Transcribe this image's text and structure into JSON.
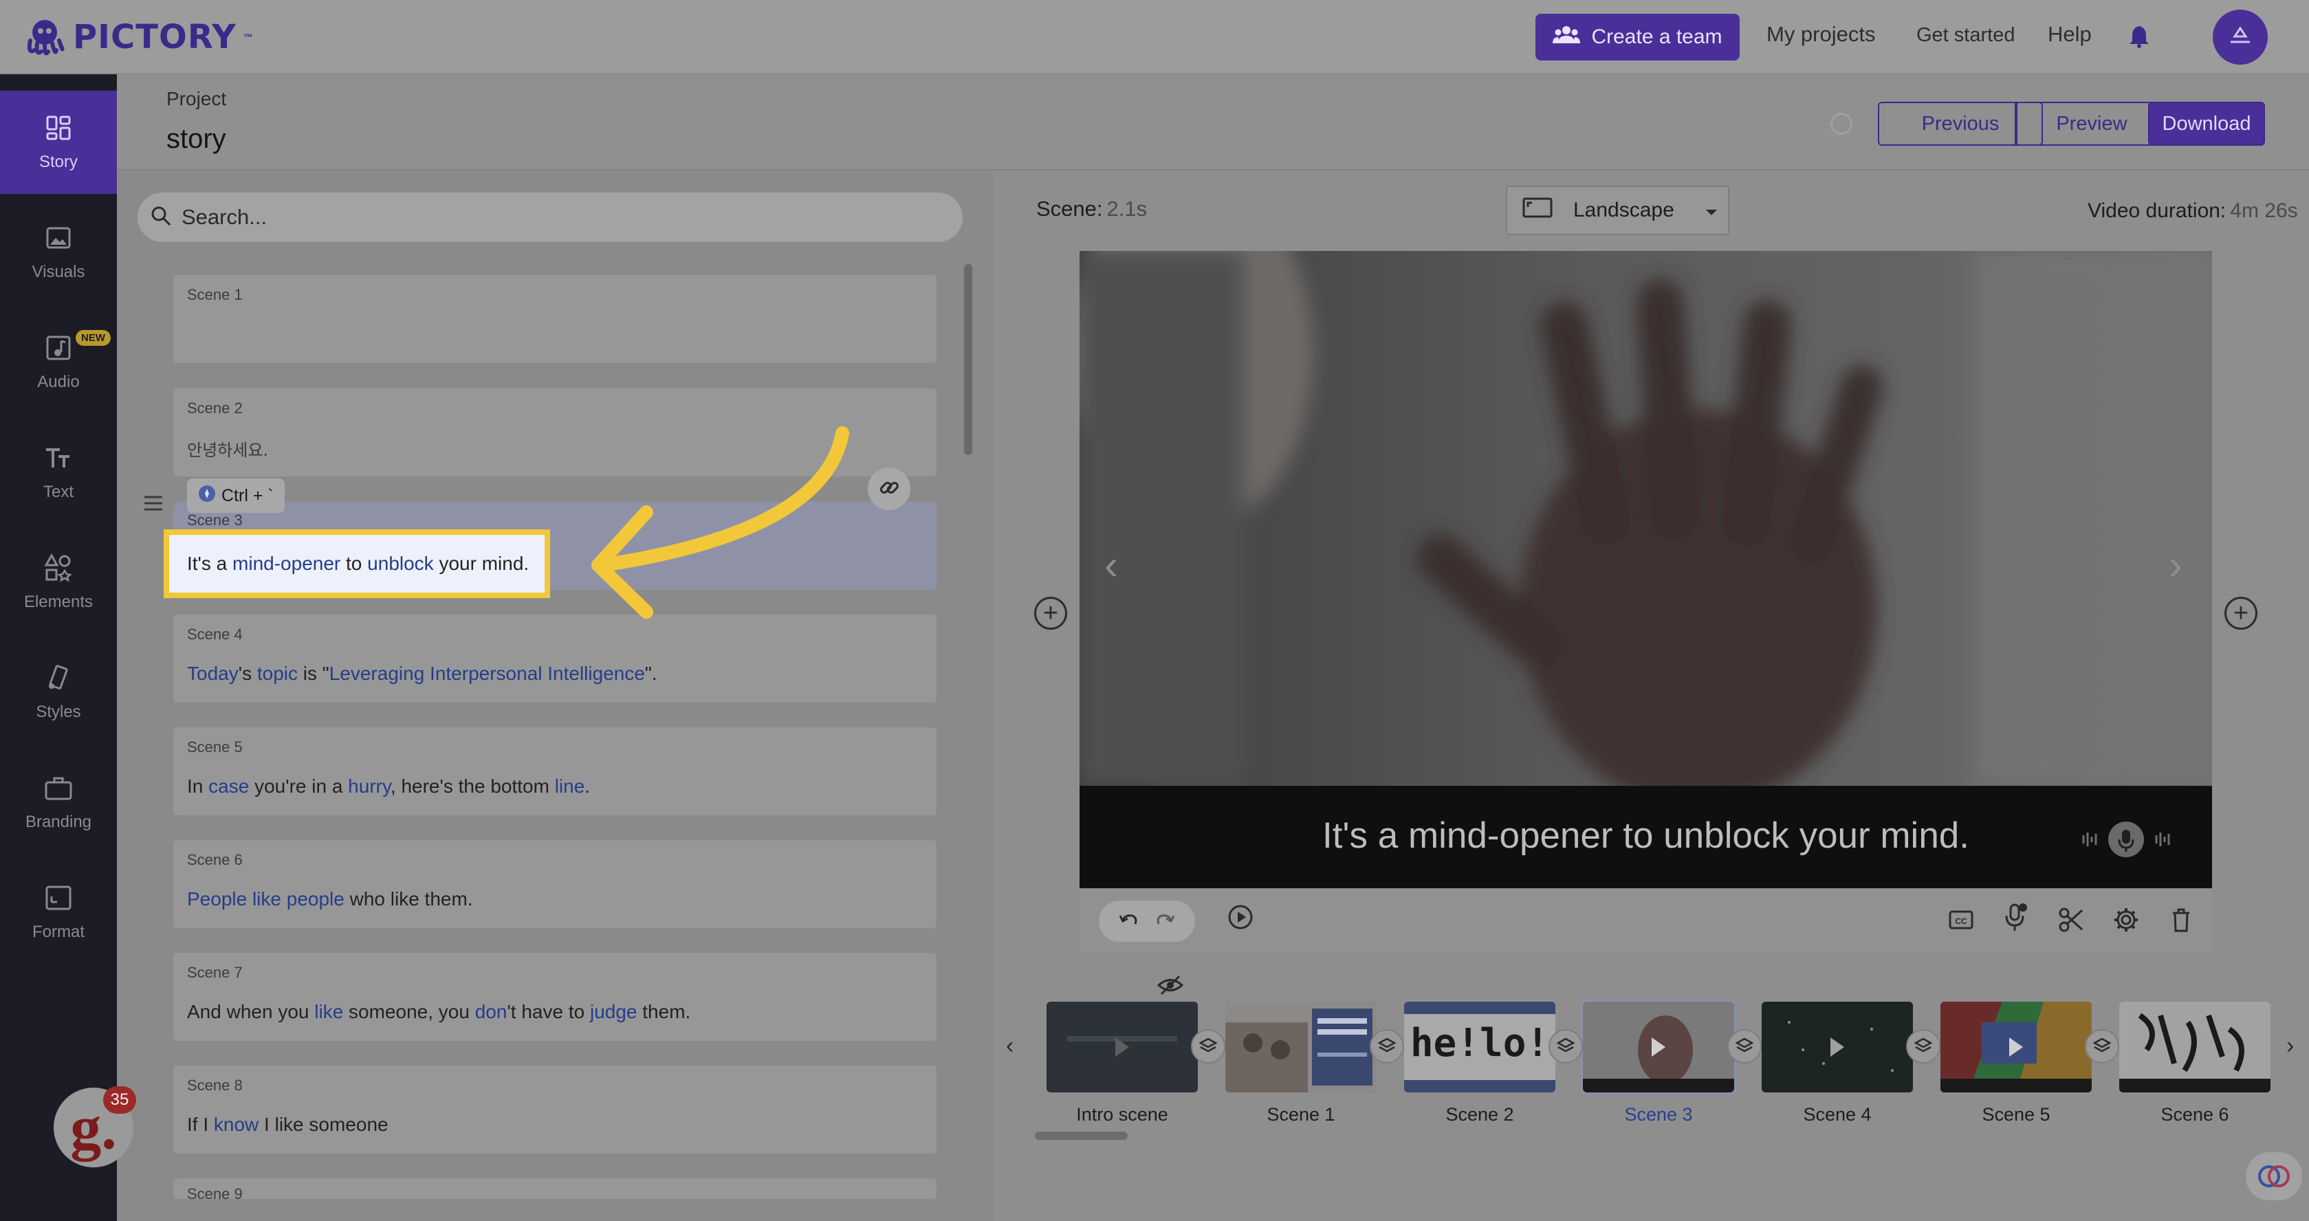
{
  "app": {
    "name": "PICTORY",
    "tm": "™"
  },
  "topbar": {
    "create_team": "Create a team",
    "my_projects": "My projects",
    "get_started": "Get started",
    "help": "Help"
  },
  "sidebar": {
    "items": [
      {
        "label": "Story",
        "icon": "story-icon"
      },
      {
        "label": "Visuals",
        "icon": "image-icon"
      },
      {
        "label": "Audio",
        "icon": "music-icon",
        "badge": "NEW"
      },
      {
        "label": "Text",
        "icon": "text-icon"
      },
      {
        "label": "Elements",
        "icon": "shapes-icon"
      },
      {
        "label": "Styles",
        "icon": "styles-icon"
      },
      {
        "label": "Branding",
        "icon": "briefcase-icon"
      },
      {
        "label": "Format",
        "icon": "format-icon"
      }
    ]
  },
  "project": {
    "label": "Project",
    "name": "story",
    "buttons": {
      "previous": "Previous",
      "preview": "Preview",
      "download": "Download"
    }
  },
  "search": {
    "placeholder": "Search..."
  },
  "scenes": [
    {
      "label": "Scene 1",
      "text": ""
    },
    {
      "label": "Scene 2",
      "text": "안녕하세요."
    },
    {
      "label": "Scene 3",
      "parts": [
        "It's a ",
        "mind-opener",
        " to ",
        "unblock",
        " your mind."
      ]
    },
    {
      "label": "Scene 4",
      "parts": [
        "Today",
        "'s ",
        "topic",
        " is \"",
        "Leveraging Interpersonal Intelligence",
        "\"."
      ]
    },
    {
      "label": "Scene 5",
      "parts": [
        "In ",
        "case",
        " you're in a ",
        "hurry",
        ", here's the bottom ",
        "line",
        "."
      ]
    },
    {
      "label": "Scene 6",
      "parts": [
        "People like people",
        " who like them."
      ]
    },
    {
      "label": "Scene 7",
      "parts": [
        "And when you ",
        "like",
        " someone, you ",
        "don",
        "'t have to ",
        "judge",
        " them."
      ]
    },
    {
      "label": "Scene 8",
      "parts": [
        "If I ",
        "know",
        " I like someone"
      ]
    },
    {
      "label": "Scene 9"
    }
  ],
  "shortcut_tip": "Ctrl + `",
  "editor": {
    "scene_label": "Scene:",
    "scene_duration": "2.1s",
    "aspect": "Landscape",
    "video_duration_label": "Video duration:",
    "video_duration": "4m 26s",
    "caption": "It's a mind-opener to unblock your mind."
  },
  "timeline": {
    "thumbs": [
      {
        "label": "Intro scene"
      },
      {
        "label": "Scene 1"
      },
      {
        "label": "Scene 2",
        "overlay": "he!lo!"
      },
      {
        "label": "Scene 3",
        "active": true
      },
      {
        "label": "Scene 4"
      },
      {
        "label": "Scene 5"
      },
      {
        "label": "Scene 6"
      }
    ]
  },
  "grammarly_count": "35",
  "colors": {
    "brand": "#4a2f99",
    "highlight": "#f2c83a",
    "keyword": "#243d8a"
  }
}
